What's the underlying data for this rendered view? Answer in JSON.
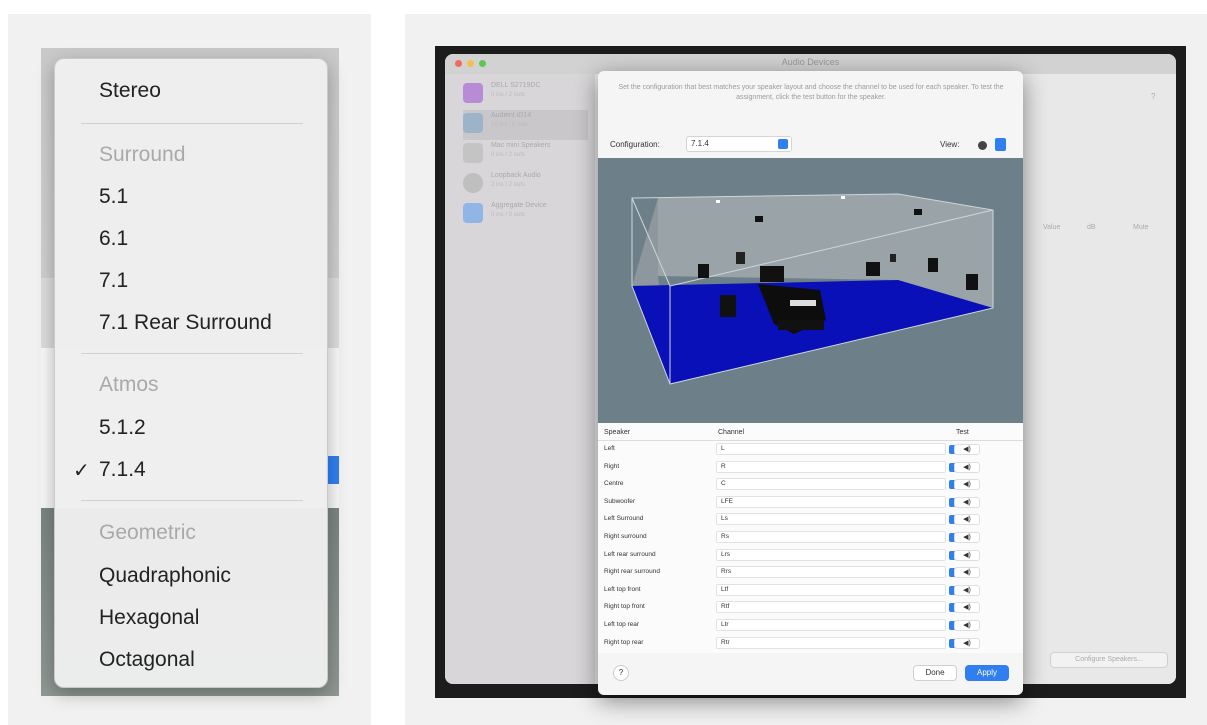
{
  "menu": {
    "stereo": "Stereo",
    "surround_header": "Surround",
    "surround_items": [
      "5.1",
      "6.1",
      "7.1",
      "7.1 Rear Surround"
    ],
    "atmos_header": "Atmos",
    "atmos_items": [
      "5.1.2",
      "7.1.4"
    ],
    "selected": "7.1.4",
    "check_glyph": "✓",
    "geometric_header": "Geometric",
    "geometric_items": [
      "Quadraphonic",
      "Hexagonal",
      "Octagonal"
    ]
  },
  "window": {
    "title": "Audio Devices",
    "devices": [
      {
        "name": "DELL S2719DC",
        "sub": "0 ins / 2 outs"
      },
      {
        "name": "Audient iD14",
        "sub": "10 ins / 8 outs"
      },
      {
        "name": "Mac mini Speakers",
        "sub": "0 ins / 2 outs"
      },
      {
        "name": "Loopback Audio",
        "sub": "2 ins / 2 outs"
      },
      {
        "name": "Aggregate Device",
        "sub": "0 ins / 0 outs"
      }
    ],
    "columns": [
      "Value",
      "dB",
      "Mute"
    ],
    "help_glyph": "?",
    "configure_button": "Configure Speakers..."
  },
  "sheet": {
    "description": "Set the configuration that best matches your speaker layout and choose the channel to be used for each speaker. To test the assignment, click the test button for the speaker.",
    "config_label": "Configuration:",
    "config_value": "7.1.4",
    "view_label": "View:",
    "table_headers": {
      "speaker": "Speaker",
      "channel": "Channel",
      "test": "Test"
    },
    "rows": [
      {
        "speaker": "Left",
        "channel": "L"
      },
      {
        "speaker": "Right",
        "channel": "R"
      },
      {
        "speaker": "Centre",
        "channel": "C"
      },
      {
        "speaker": "Subwoofer",
        "channel": "LFE"
      },
      {
        "speaker": "Left Surround",
        "channel": "Ls"
      },
      {
        "speaker": "Right surround",
        "channel": "Rs"
      },
      {
        "speaker": "Left rear surround",
        "channel": "Lrs"
      },
      {
        "speaker": "Right rear surround",
        "channel": "Rrs"
      },
      {
        "speaker": "Left top front",
        "channel": "Ltf"
      },
      {
        "speaker": "Right top front",
        "channel": "Rtf"
      },
      {
        "speaker": "Left top rear",
        "channel": "Ltr"
      },
      {
        "speaker": "Right top rear",
        "channel": "Rtr"
      }
    ],
    "test_glyph": "◀)",
    "help_glyph": "?",
    "done_label": "Done",
    "apply_label": "Apply"
  },
  "colors": {
    "accent": "#2f7ff0",
    "floor": "#0a10b8",
    "room_bg": "#6d8089"
  }
}
